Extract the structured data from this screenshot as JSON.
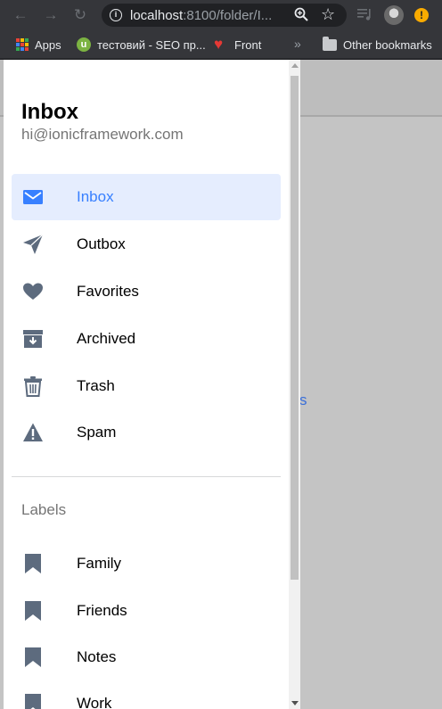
{
  "browser": {
    "url_host": "localhost",
    "url_rest": ":8100/folder/I...",
    "bookmarks": [
      {
        "label": "Apps",
        "icon": "apps-grid-icon"
      },
      {
        "label": "тестовий - SEO пр...",
        "icon": "seo-site-icon"
      },
      {
        "label": "Front",
        "icon": "heart-icon"
      }
    ],
    "more_bookmarks": "»",
    "other_bookmarks": "Other bookmarks"
  },
  "underlay": {
    "link_fragment": "s"
  },
  "menu": {
    "title": "Inbox",
    "subtitle": "hi@ionicframework.com",
    "accent_color": "#3880ff",
    "icon_color": "#5d6b7e",
    "items": [
      {
        "label": "Inbox",
        "icon": "mail-icon",
        "active": true
      },
      {
        "label": "Outbox",
        "icon": "paper-plane-icon",
        "active": false
      },
      {
        "label": "Favorites",
        "icon": "heart-icon",
        "active": false
      },
      {
        "label": "Archived",
        "icon": "archive-icon",
        "active": false
      },
      {
        "label": "Trash",
        "icon": "trash-icon",
        "active": false
      },
      {
        "label": "Spam",
        "icon": "warning-icon",
        "active": false
      }
    ],
    "labels_header": "Labels",
    "labels": [
      {
        "label": "Family",
        "icon": "bookmark-icon"
      },
      {
        "label": "Friends",
        "icon": "bookmark-icon"
      },
      {
        "label": "Notes",
        "icon": "bookmark-icon"
      },
      {
        "label": "Work",
        "icon": "bookmark-icon"
      }
    ]
  }
}
